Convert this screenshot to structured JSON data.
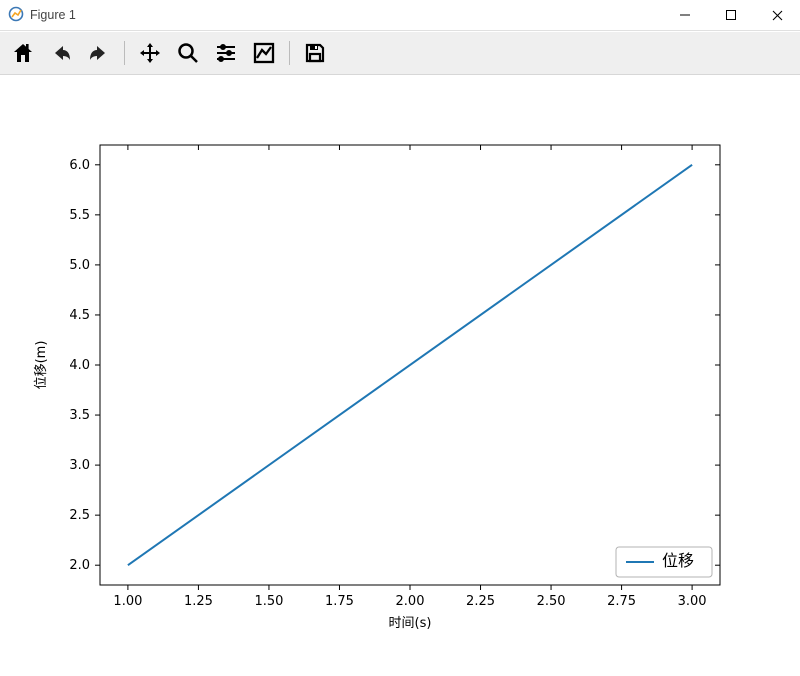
{
  "window": {
    "title": "Figure 1"
  },
  "toolbar": {
    "home": "Home",
    "back": "Back",
    "forward": "Forward",
    "pan": "Pan",
    "zoom": "Zoom",
    "subplots": "Configure subplots",
    "axes": "Edit axis",
    "save": "Save"
  },
  "chart_data": {
    "type": "line",
    "x": [
      1.0,
      3.0
    ],
    "series": [
      {
        "name": "位移",
        "values": [
          2.0,
          6.0
        ],
        "color": "#1f77b4"
      }
    ],
    "xlabel": "时间(s)",
    "ylabel": "位移(m)",
    "xticks": [
      1.0,
      1.25,
      1.5,
      1.75,
      2.0,
      2.25,
      2.5,
      2.75,
      3.0
    ],
    "xtick_labels": [
      "1.00",
      "1.25",
      "1.50",
      "1.75",
      "2.00",
      "2.25",
      "2.50",
      "2.75",
      "3.00"
    ],
    "yticks": [
      2.0,
      2.5,
      3.0,
      3.5,
      4.0,
      4.5,
      5.0,
      5.5,
      6.0
    ],
    "ytick_labels": [
      "2.0",
      "2.5",
      "3.0",
      "3.5",
      "4.0",
      "4.5",
      "5.0",
      "5.5",
      "6.0"
    ],
    "xlim": [
      1.0,
      3.0
    ],
    "ylim": [
      2.0,
      6.0
    ],
    "legend_position": "lower right"
  }
}
